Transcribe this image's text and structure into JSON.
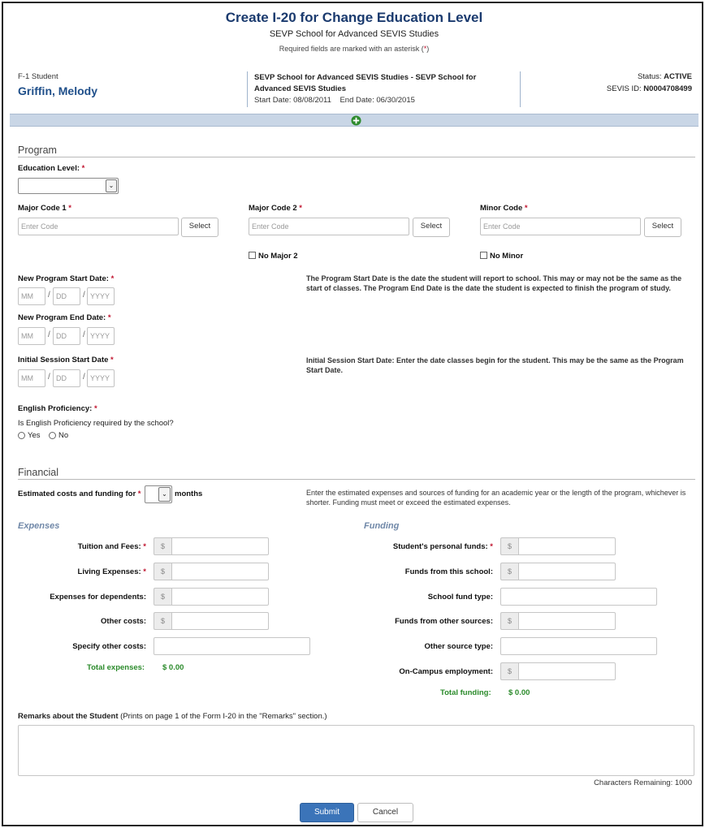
{
  "page": {
    "title": "Create I-20 for Change Education Level",
    "subtitle": "SEVP School for Advanced SEVIS Studies",
    "required_note_prefix": "Required fields are marked with an asterisk (",
    "required_note_star": "*",
    "required_note_suffix": ")"
  },
  "student": {
    "type": "F-1 Student",
    "name": "Griffin, Melody",
    "program_line": "SEVP School for Advanced SEVIS Studies - SEVP School for Advanced SEVIS Studies",
    "start_label": "Start Date:",
    "start_date": "08/08/2011",
    "end_label": "End Date:",
    "end_date": "06/30/2015",
    "status_label": "Status:",
    "status": "ACTIVE",
    "sevis_label": "SEVIS ID:",
    "sevis_id": "N0004708499"
  },
  "program": {
    "section_title": "Program",
    "education_level_label": "Education Level:",
    "education_level_value": "",
    "major1_label": "Major Code 1",
    "major2_label": "Major Code 2",
    "minor_label": "Minor Code",
    "code_placeholder": "Enter Code",
    "select_label": "Select",
    "no_major2_label": "No Major 2",
    "no_minor_label": "No Minor",
    "new_start_label": "New Program Start Date:",
    "new_end_label": "New Program End Date:",
    "initial_session_label": "Initial Session Start Date",
    "mm_placeholder": "MM",
    "dd_placeholder": "DD",
    "yyyy_placeholder": "YYYY",
    "date_sep": "/",
    "program_dates_note": "The Program Start Date is the date the student will report to school. This may or may not be the same as the start of classes. The Program End Date is the date the student is expected to finish the program of study.",
    "session_note": "Initial Session Start Date: Enter the date classes begin for the student. This may be the same as the Program Start Date.",
    "english_label": "English Proficiency:",
    "english_question": "Is English Proficiency required by the school?",
    "yes_label": "Yes",
    "no_label": "No"
  },
  "financial": {
    "section_title": "Financial",
    "estimated_label": "Estimated costs and funding for",
    "months_label": "months",
    "months_value": "",
    "note": "Enter the estimated expenses and sources of funding for an academic year or the length of the program, whichever is shorter. Funding must meet or exceed the estimated expenses.",
    "expenses_title": "Expenses",
    "funding_title": "Funding",
    "currency": "$",
    "tuition_label": "Tuition and Fees:",
    "living_label": "Living Expenses:",
    "dependents_label": "Expenses for dependents:",
    "other_costs_label": "Other costs:",
    "specify_other_label": "Specify other costs:",
    "total_expenses_label": "Total expenses:",
    "total_expenses_value": "$ 0.00",
    "personal_funds_label": "Student's personal funds:",
    "school_funds_label": "Funds from this school:",
    "school_fund_type_label": "School fund type:",
    "other_sources_label": "Funds from other sources:",
    "other_source_type_label": "Other source type:",
    "on_campus_label": "On-Campus employment:",
    "total_funding_label": "Total funding:",
    "total_funding_value": "$ 0.00"
  },
  "remarks": {
    "label_bold": "Remarks about the Student",
    "label_note": "(Prints on page 1 of the Form I-20 in the \"Remarks\" section.)",
    "value": "",
    "chars_label": "Characters Remaining: 1000"
  },
  "actions": {
    "submit_label": "Submit",
    "cancel_label": "Cancel"
  },
  "colors": {
    "title": "#1a3a6e",
    "required": "#c0142f",
    "accent_bar": "#c9d6e6",
    "submit": "#3b74b9",
    "add_icon": "#2e8b2e",
    "totals": "#2a8a2a"
  },
  "icons": {
    "expand": "plus-circle-icon",
    "dropdown": "chevron-down-icon"
  }
}
